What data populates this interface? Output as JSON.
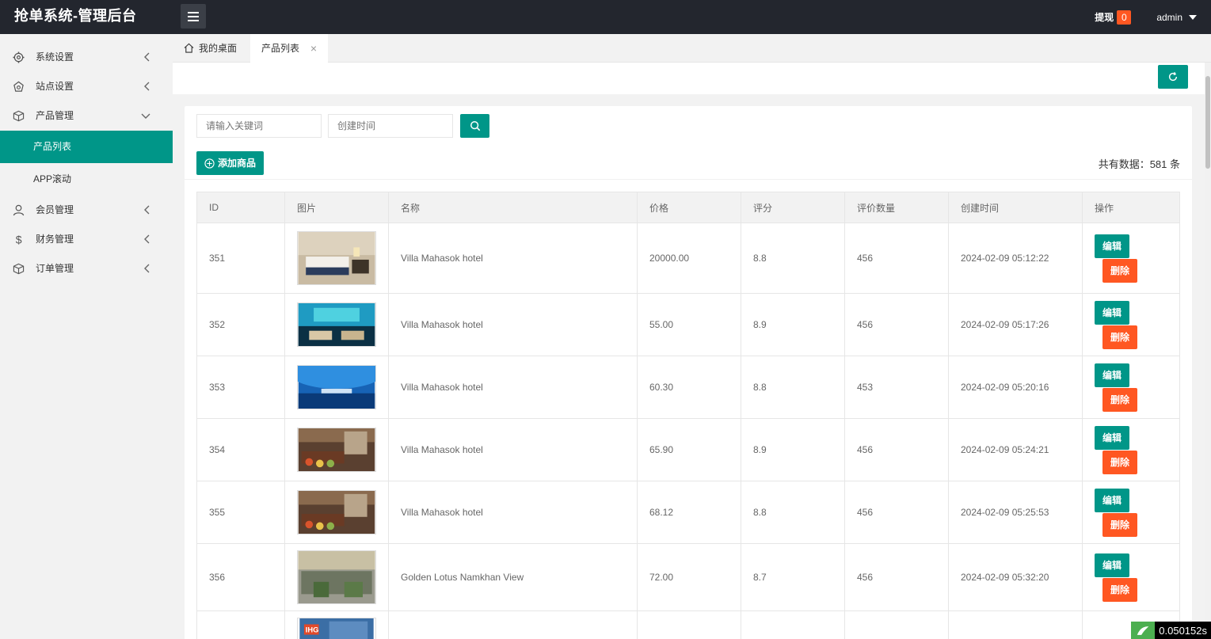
{
  "header": {
    "title": "抢单系统-管理后台",
    "withdraw_label": "提现",
    "withdraw_count": "0",
    "username": "admin"
  },
  "sidebar": {
    "items": [
      {
        "label": "系统设置",
        "icon": "gear-icon",
        "expanded": false
      },
      {
        "label": "站点设置",
        "icon": "site-icon",
        "expanded": false
      },
      {
        "label": "产品管理",
        "icon": "box-icon",
        "expanded": true,
        "children": [
          {
            "label": "产品列表",
            "active": true
          },
          {
            "label": "APP滚动",
            "active": false
          }
        ]
      },
      {
        "label": "会员管理",
        "icon": "user-icon",
        "expanded": false
      },
      {
        "label": "财务管理",
        "icon": "dollar-icon",
        "expanded": false
      },
      {
        "label": "订单管理",
        "icon": "box-icon",
        "expanded": false
      }
    ]
  },
  "tabs": {
    "home": "我的桌面",
    "current": "产品列表"
  },
  "filters": {
    "keyword_placeholder": "请输入关键词",
    "time_placeholder": "创建时间"
  },
  "actions": {
    "add_label": "添加商品",
    "total_label": "共有数据：581 条"
  },
  "table": {
    "columns": [
      "ID",
      "图片",
      "名称",
      "价格",
      "评分",
      "评价数量",
      "创建时间",
      "操作"
    ],
    "edit_label": "编辑",
    "delete_label": "删除",
    "rows": [
      {
        "id": "351",
        "name": "Villa Mahasok hotel",
        "price": "20000.00",
        "score": "8.8",
        "reviews": "456",
        "created": "2024-02-09 05:12:22",
        "img": "bedroom"
      },
      {
        "id": "352",
        "name": "Villa Mahasok hotel",
        "price": "55.00",
        "score": "8.9",
        "reviews": "456",
        "created": "2024-02-09 05:17:26",
        "img": "aquarium"
      },
      {
        "id": "353",
        "name": "Villa Mahasok hotel",
        "price": "60.30",
        "score": "8.8",
        "reviews": "453",
        "created": "2024-02-09 05:20:16",
        "img": "dome"
      },
      {
        "id": "354",
        "name": "Villa Mahasok hotel",
        "price": "65.90",
        "score": "8.9",
        "reviews": "456",
        "created": "2024-02-09 05:24:21",
        "img": "buffet"
      },
      {
        "id": "355",
        "name": "Villa Mahasok hotel",
        "price": "68.12",
        "score": "8.8",
        "reviews": "456",
        "created": "2024-02-09 05:25:53",
        "img": "buffet"
      },
      {
        "id": "356",
        "name": "Golden Lotus Namkhan View",
        "price": "72.00",
        "score": "8.7",
        "reviews": "456",
        "created": "2024-02-09 05:32:20",
        "img": "lobby"
      },
      {
        "id": "",
        "name": "",
        "price": "",
        "score": "",
        "reviews": "",
        "created": "",
        "img": "facade"
      }
    ]
  },
  "timer": "0.050152s",
  "colors": {
    "accent": "#009688",
    "danger": "#ff5722",
    "header_bg": "#23262e"
  }
}
